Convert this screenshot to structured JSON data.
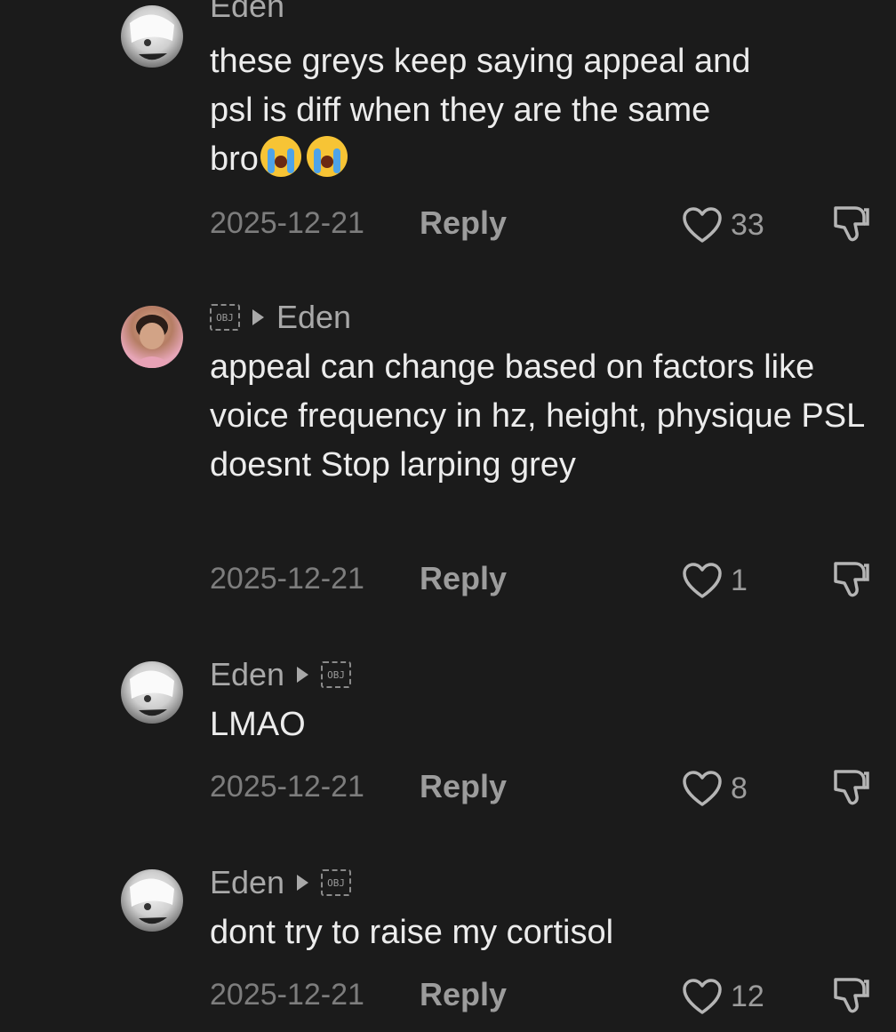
{
  "comments": [
    {
      "author": "Eden",
      "text_line1": "these greys keep saying appeal and",
      "text_line2": "psl is diff when they are the same",
      "text_line3": "bro",
      "emoji": [
        "loudly-crying-face",
        "loudly-crying-face"
      ],
      "date": "2025-12-21",
      "reply_label": "Reply",
      "likes": "33"
    },
    {
      "reply_to": "Eden",
      "text": "appeal can change based on factors like voice frequency in hz, height, physique PSL doesnt Stop larping grey",
      "date": "2025-12-21",
      "reply_label": "Reply",
      "likes": "1"
    },
    {
      "author": "Eden",
      "text": "LMAO",
      "date": "2025-12-21",
      "reply_label": "Reply",
      "likes": "8"
    },
    {
      "author": "Eden",
      "text": "dont try to raise my cortisol",
      "date": "2025-12-21",
      "reply_label": "Reply",
      "likes": "12"
    }
  ],
  "obj_placeholder": "OBJ",
  "colors": {
    "background": "#1b1b1b",
    "text": "#ececec",
    "muted": "#9c9c9c"
  },
  "icons": {
    "like": "heart-outline-icon",
    "dislike": "thumbs-down-icon"
  }
}
